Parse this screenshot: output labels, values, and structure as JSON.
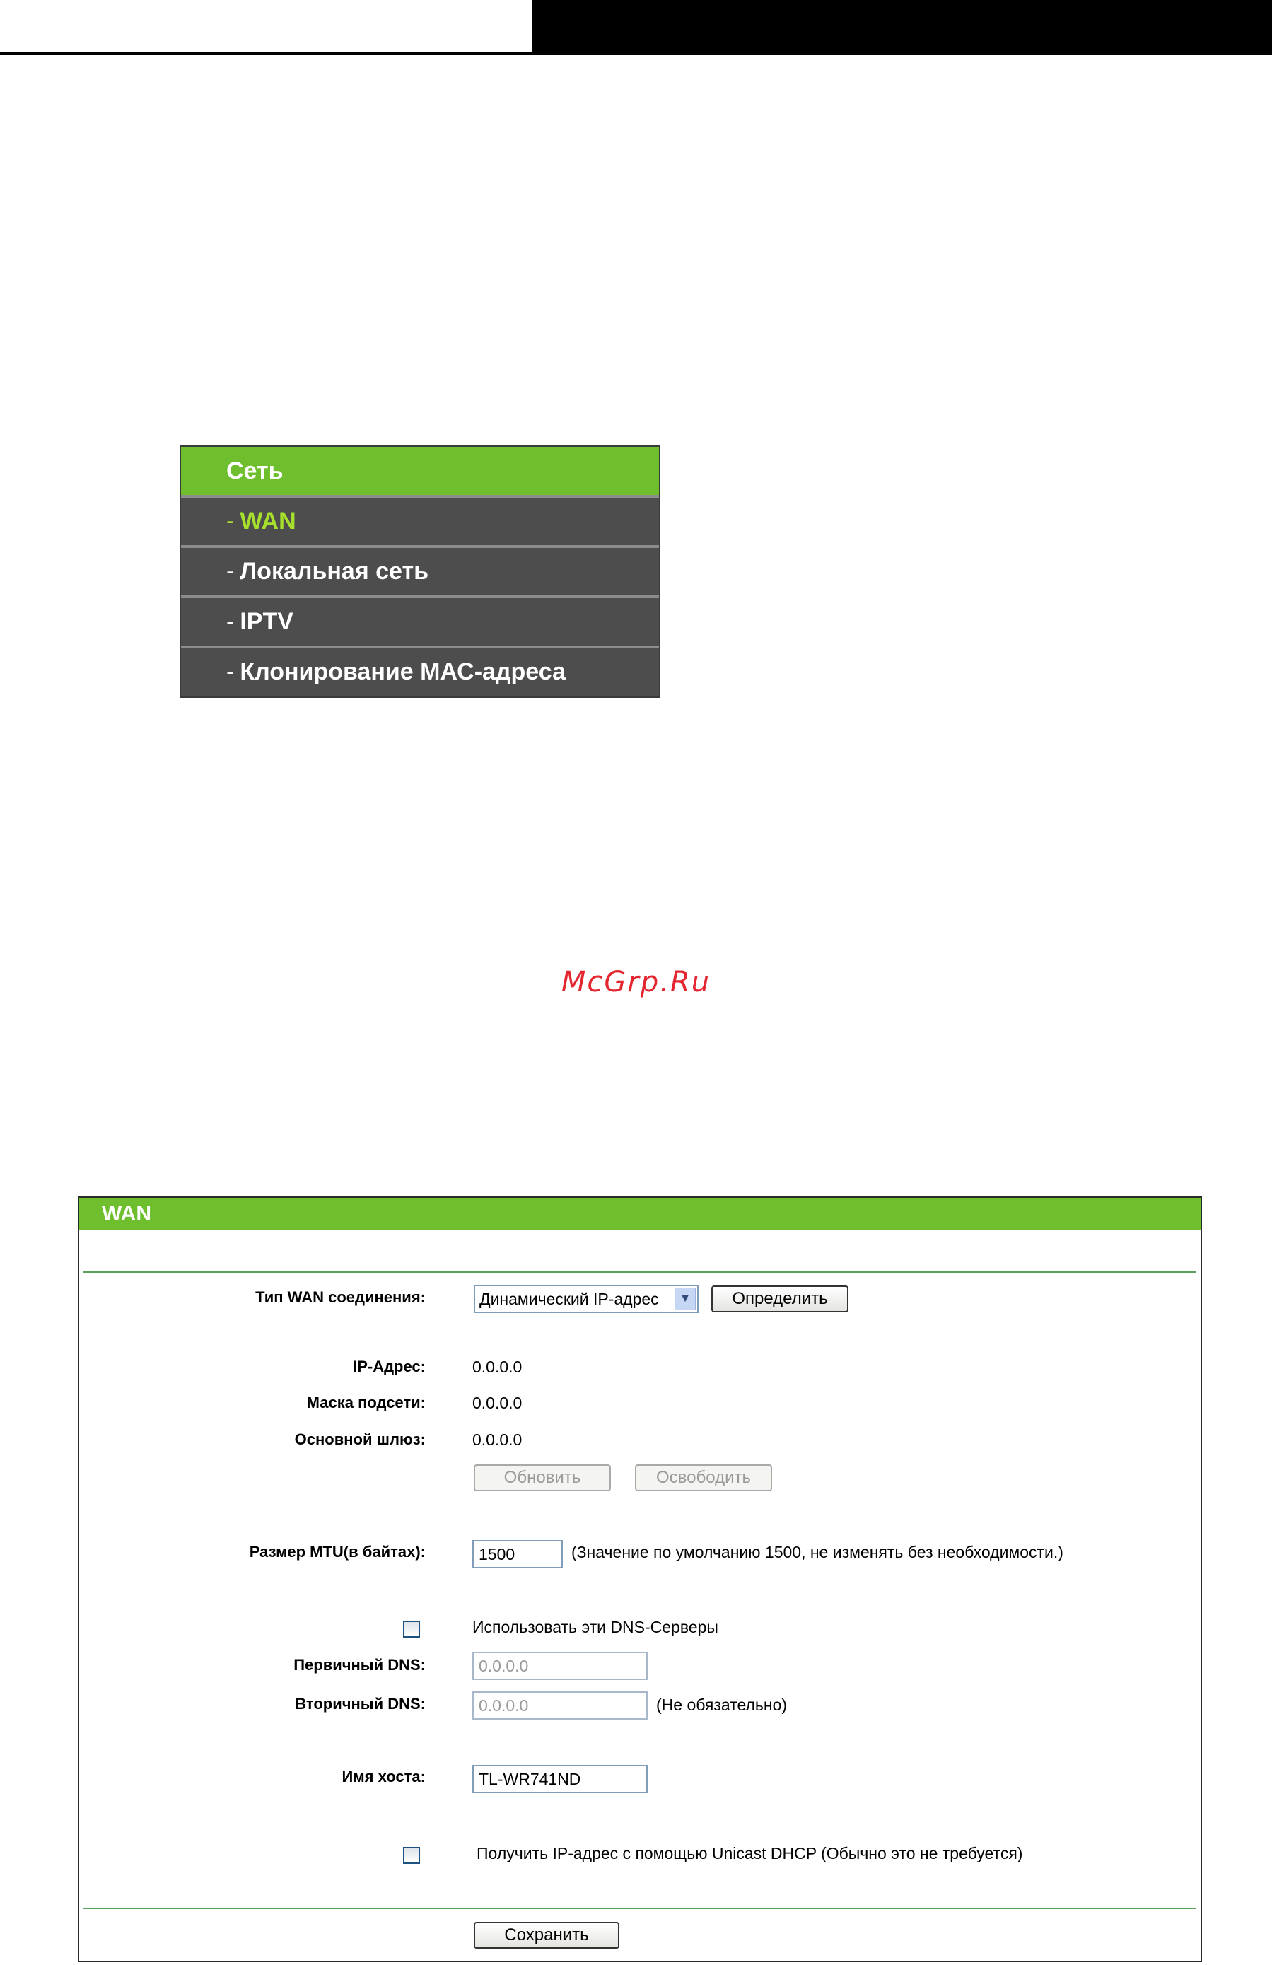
{
  "menu": {
    "header": "Сеть",
    "items": [
      {
        "label": "WAN",
        "active": true
      },
      {
        "label": "Локальная сеть",
        "active": false
      },
      {
        "label": "IPTV",
        "active": false
      },
      {
        "label": "Клонирование МАС-адреса",
        "active": false
      }
    ],
    "dash": "-"
  },
  "watermark": "McGrp.Ru",
  "wan": {
    "title": "WAN",
    "connection_type_label": "Тип WAN соединения:",
    "connection_type_value": "Динамический IP-адрес",
    "detect_button": "Определить",
    "ip_label": "IP-Адрес:",
    "ip_value": "0.0.0.0",
    "mask_label": "Маска подсети:",
    "mask_value": "0.0.0.0",
    "gateway_label": "Основной шлюз:",
    "gateway_value": "0.0.0.0",
    "renew_button": "Обновить",
    "release_button": "Освободить",
    "mtu_label": "Размер MTU(в байтах):",
    "mtu_value": "1500",
    "mtu_note": "(Значение по умолчанию 1500, не изменять без необходимости.)",
    "use_dns_label": "Использовать эти DNS-Серверы",
    "primary_dns_label": "Первичный DNS:",
    "primary_dns_value": "0.0.0.0",
    "secondary_dns_label": "Вторичный DNS:",
    "secondary_dns_value": "0.0.0.0",
    "secondary_dns_note": "(Не обязательно)",
    "hostname_label": "Имя хоста:",
    "hostname_value": "TL-WR741ND",
    "unicast_label": "Получить IP-адрес с помощью Unicast DHCP (Обычно это не требуется)",
    "save_button": "Сохранить"
  },
  "colors": {
    "accent_green": "#6fbe2e",
    "active_item": "#a6e02c",
    "watermark": "#e3262f"
  }
}
